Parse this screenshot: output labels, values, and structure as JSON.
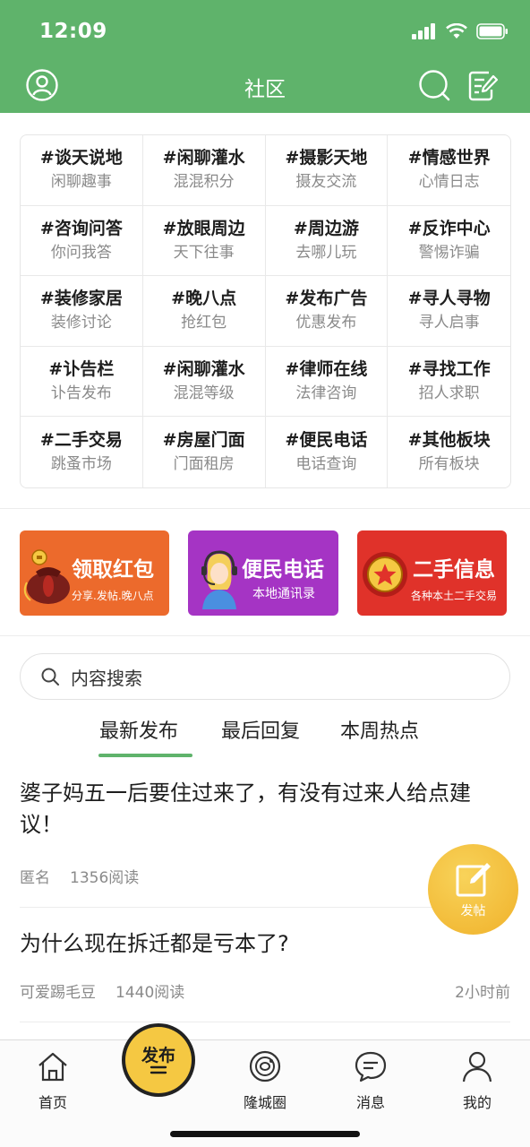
{
  "status_bar": {
    "time": "12:09"
  },
  "nav": {
    "title": "社区"
  },
  "topics": [
    {
      "title": "#谈天说地",
      "sub": "闲聊趣事"
    },
    {
      "title": "#闲聊灌水",
      "sub": "混混积分"
    },
    {
      "title": "#摄影天地",
      "sub": "摄友交流"
    },
    {
      "title": "#情感世界",
      "sub": "心情日志"
    },
    {
      "title": "#咨询问答",
      "sub": "你问我答"
    },
    {
      "title": "#放眼周边",
      "sub": "天下往事"
    },
    {
      "title": "#周边游",
      "sub": "去哪儿玩"
    },
    {
      "title": "#反诈中心",
      "sub": "警惕诈骗"
    },
    {
      "title": "#装修家居",
      "sub": "装修讨论"
    },
    {
      "title": "#晚八点",
      "sub": "抢红包"
    },
    {
      "title": "#发布广告",
      "sub": "优惠发布"
    },
    {
      "title": "#寻人寻物",
      "sub": "寻人启事"
    },
    {
      "title": "#讣告栏",
      "sub": "讣告发布"
    },
    {
      "title": "#闲聊灌水",
      "sub": "混混等级"
    },
    {
      "title": "#律师在线",
      "sub": "法律咨询"
    },
    {
      "title": "#寻找工作",
      "sub": "招人求职"
    },
    {
      "title": "#二手交易",
      "sub": "跳蚤市场"
    },
    {
      "title": "#房屋门面",
      "sub": "门面租房"
    },
    {
      "title": "#便民电话",
      "sub": "电话查询"
    },
    {
      "title": "#其他板块",
      "sub": "所有板块"
    }
  ],
  "banners": [
    {
      "title": "领取红包",
      "sub": "分享.发帖.晚八点",
      "color": "#ec6a2c",
      "icon": "money-bag-icon"
    },
    {
      "title": "便民电话",
      "sub": "本地通讯录",
      "color": "#a534c4",
      "icon": "operator-icon"
    },
    {
      "title": "二手信息",
      "sub": "各种本土二手交易",
      "color": "#e0322a",
      "icon": "coin-icon"
    }
  ],
  "search": {
    "placeholder": "内容搜索"
  },
  "tabs": [
    "最新发布",
    "最后回复",
    "本周热点"
  ],
  "active_tab": 0,
  "posts": [
    {
      "title": "婆子妈五一后要住过来了，有没有过来人给点建议！",
      "author": "匿名",
      "reads": "1356阅读",
      "time": ""
    },
    {
      "title": "为什么现在拆迁都是亏本了?",
      "author": "可爱踢毛豆",
      "reads": "1440阅读",
      "time": "2小时前"
    }
  ],
  "fab": {
    "label": "发帖"
  },
  "tabbar": {
    "home": "首页",
    "publish": "发布",
    "circle": "隆城圈",
    "messages": "消息",
    "mine": "我的"
  },
  "colors": {
    "primary": "#5fb36b",
    "accent": "#f5c842"
  }
}
